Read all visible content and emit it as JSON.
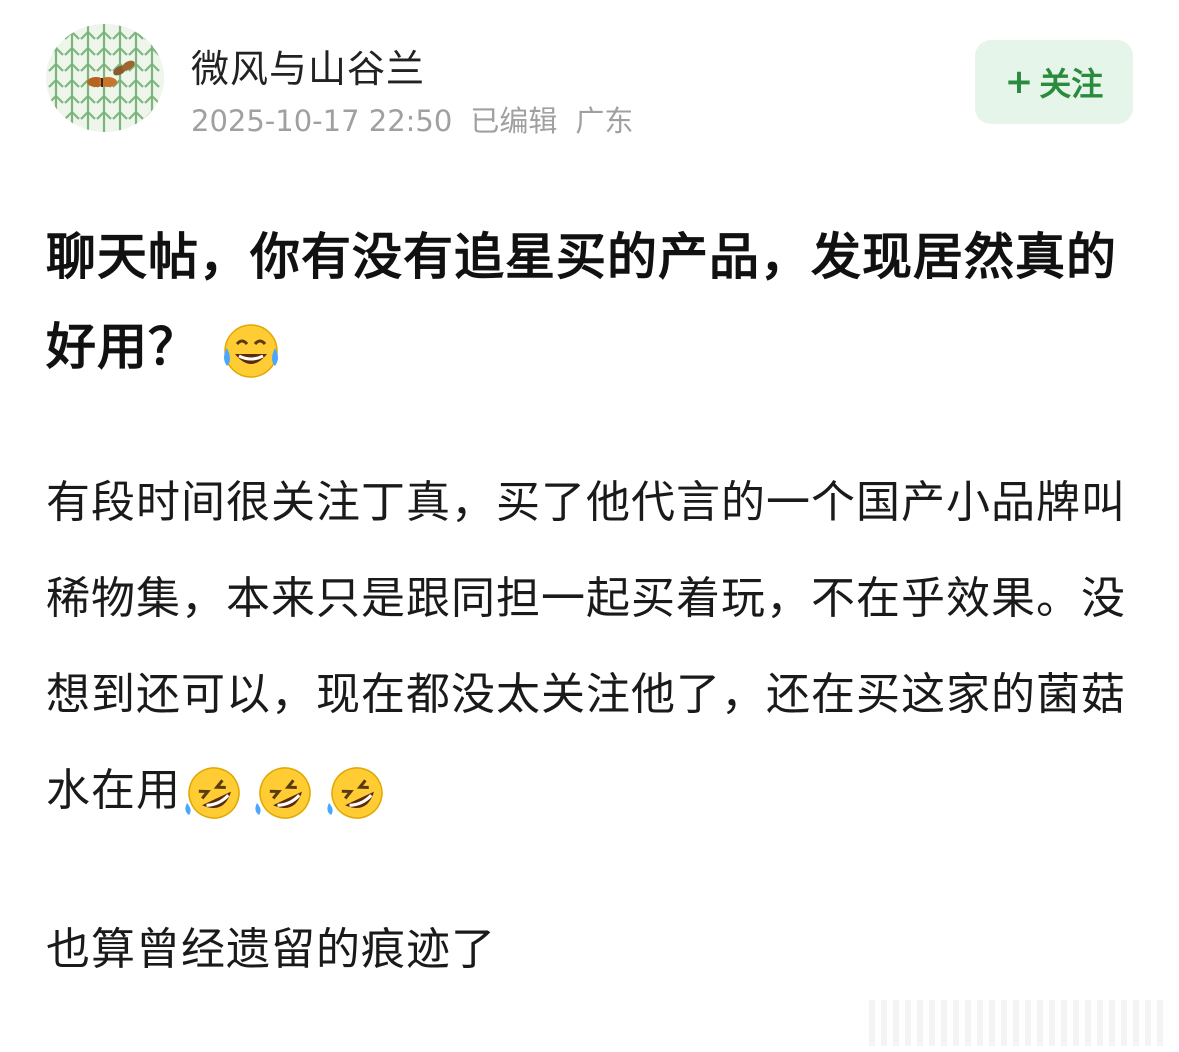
{
  "author": {
    "name": "微风与山谷兰",
    "timestamp": "2025-10-17 22:50",
    "edited": "已编辑",
    "location": "广东",
    "avatar_icon": "leaf-pattern-avatar"
  },
  "follow_button": {
    "plus": "+",
    "label": "关注"
  },
  "post": {
    "title": "聊天帖，你有没有追星买的产品，发现居然真的好用？",
    "title_emoji": "tears-of-joy-emoji",
    "body": "有段时间很关注丁真，买了他代言的一个国产小品牌叫稀物集，本来只是跟同担一起买着玩，不在乎效果。没想到还可以，现在都没太关注他了，还在买这家的菌菇水在用",
    "body_emojis": [
      "rofl-emoji",
      "rofl-emoji",
      "rofl-emoji"
    ],
    "closing": "也算曾经遗留的痕迹了"
  },
  "colors": {
    "accent_green": "#2a8a3e",
    "follow_bg": "#e6f5e9",
    "meta_gray": "#a0a0a0"
  }
}
